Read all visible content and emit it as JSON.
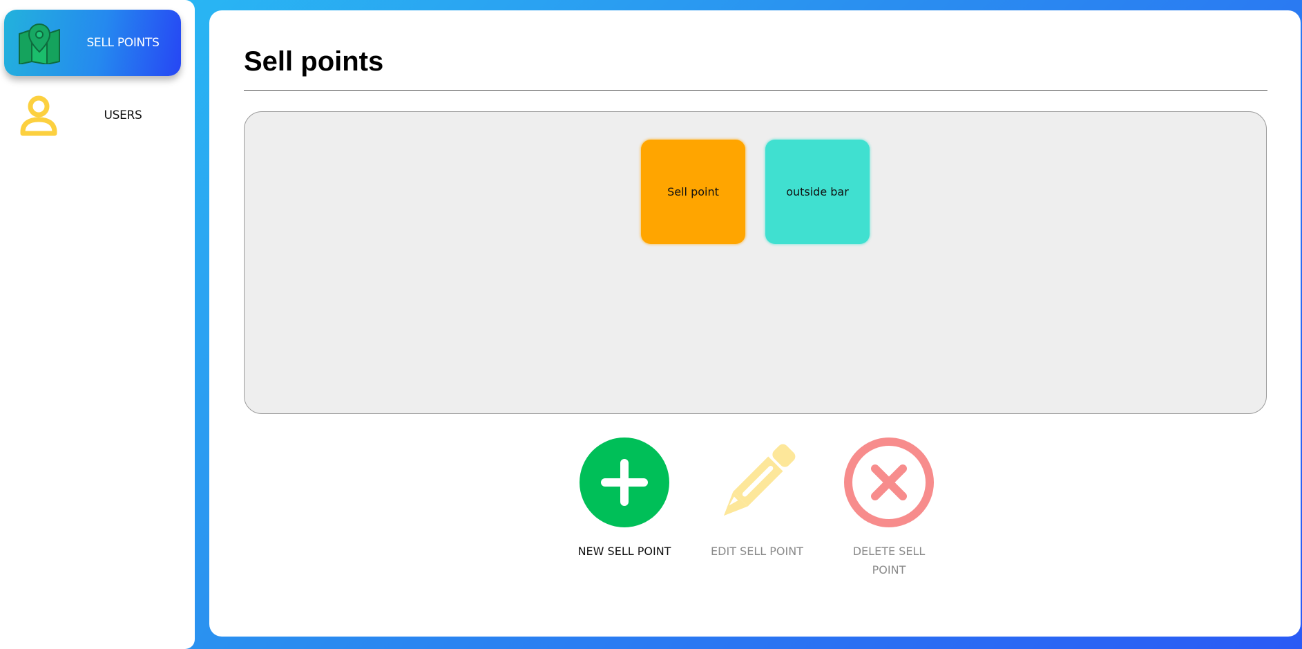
{
  "sidebar": {
    "items": [
      {
        "label": "SELL POINTS",
        "icon": "map-pin-icon",
        "active": true
      },
      {
        "label": "USERS",
        "icon": "user-icon",
        "active": false
      }
    ]
  },
  "main": {
    "title": "Sell points",
    "tiles": [
      {
        "label": "Sell point",
        "color": "#ffa500"
      },
      {
        "label": "outside bar",
        "color": "#40e0d0"
      }
    ],
    "actions": [
      {
        "label": "NEW SELL POINT",
        "icon": "plus-circle-icon",
        "color": "#00bf58",
        "enabled": true
      },
      {
        "label": "EDIT SELL POINT",
        "icon": "pencil-icon",
        "color": "#fde79a",
        "enabled": false
      },
      {
        "label": "DELETE SELL POINT",
        "icon": "x-circle-icon",
        "color": "#f78c8c",
        "enabled": false
      }
    ]
  },
  "colors": {
    "accent_gradient_start": "#29c0f4",
    "accent_gradient_end": "#2a5af5",
    "map_icon": "#1aa566",
    "user_icon": "#fcd03f"
  }
}
